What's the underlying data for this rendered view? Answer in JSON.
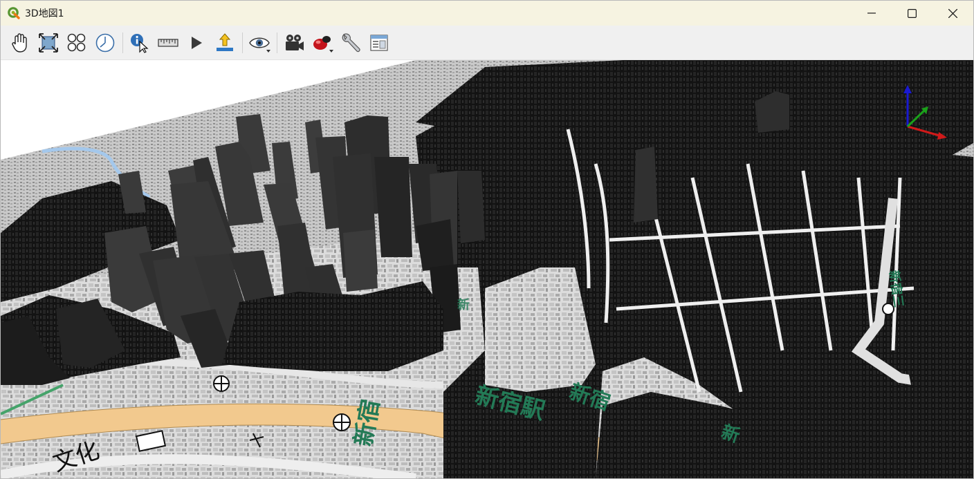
{
  "window": {
    "title": "3D地図1",
    "controls": {
      "minimize": "minimize-icon",
      "maximize": "maximize-icon",
      "close": "close-icon"
    }
  },
  "toolbar": {
    "tools": [
      "pan-icon",
      "zoom-full-icon",
      "toggle-on-screen-navigation-icon",
      "on-screen-2d-map-icon",
      "identify-icon",
      "measure-icon",
      "animation-icon",
      "export-icon",
      "camera-icon",
      "scenes-icon",
      "effects-icon",
      "options-icon",
      "map-themes-icon"
    ]
  },
  "map": {
    "labels": {
      "station": "新宿駅",
      "shinjuku_a": "新宿",
      "shinjuku_b": "新宿",
      "left": "文化",
      "mid": "新",
      "right_a": "新宿三",
      "right_b": "新"
    },
    "colors": {
      "road_major": "#f2c98e",
      "river": "#a4c8ec",
      "building": "#151515",
      "label": "#237a56",
      "axis_x": "#d11a1a",
      "axis_y": "#1aa11a",
      "axis_z": "#1a1ad1"
    }
  }
}
